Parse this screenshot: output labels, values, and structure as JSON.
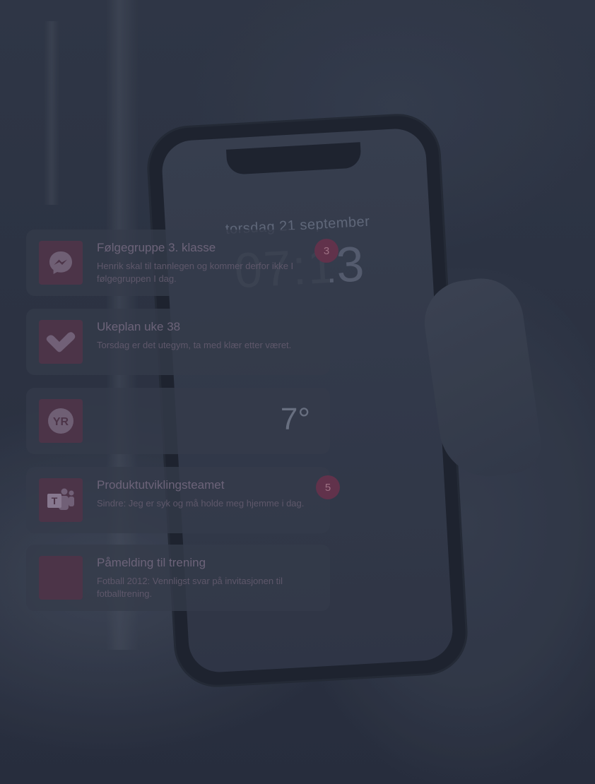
{
  "lockscreen": {
    "date": "torsdag 21 september",
    "time": "07:13"
  },
  "notifications": [
    {
      "app": "messenger",
      "icon": "messenger-icon",
      "title": "Følgegruppe 3. klasse",
      "body": "Henrik skal til tannlegen og kommer derfor ikke I følgegruppen I dag.",
      "badge": "3"
    },
    {
      "app": "ukeplan",
      "icon": "check-logo-icon",
      "title": "Ukeplan uke 38",
      "body": "Torsdag er det utegym, ta med klær etter været."
    },
    {
      "app": "yr",
      "icon": "yr-icon",
      "temperature": "7°"
    },
    {
      "app": "teams",
      "icon": "teams-icon",
      "title": "Produktutviklingsteamet",
      "body": "Sindre: Jeg er syk og må holde meg hjemme i dag.",
      "badge": "5"
    },
    {
      "app": "spond",
      "icon": "app-icon-placeholder",
      "title": "Påmelding til trening",
      "body": "Fotball 2012: Vennligst svar på invitasjonen til fotballtrening."
    }
  ],
  "colors": {
    "background": "#2d3444",
    "card": "#3a4050",
    "icon_tile": "#55384d",
    "badge": "#6e3550",
    "title_text": "#7b6f86",
    "body_text": "#6a6175"
  }
}
